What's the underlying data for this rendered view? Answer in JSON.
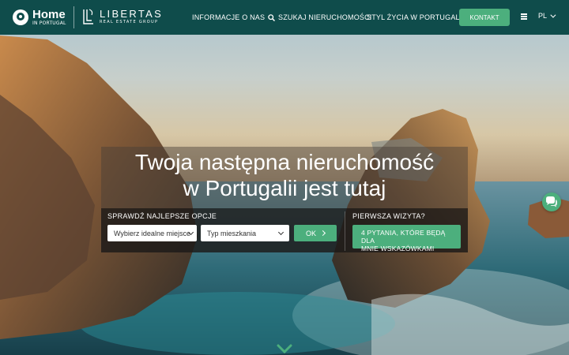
{
  "header": {
    "logo_home": {
      "title": "Home",
      "subtitle": "IN PORTUGAL"
    },
    "logo_libertas": {
      "title": "LIBERTAS",
      "subtitle": "REAL ESTATE GROUP"
    },
    "nav": {
      "about": "INFORMACJE O NAS",
      "search": "SZUKAJ NIERUCHOMOŚCI",
      "lifestyle": "STYL ŻYCIA W PORTUGALII"
    },
    "contact_label": "KONTAKT",
    "language": "PL"
  },
  "hero": {
    "headline_line1": "Twoja następna nieruchomość",
    "headline_line2": "w Portugalii jest tutaj"
  },
  "search_panel": {
    "best_options_label": "SPRAWDŹ NAJLEPSZE OPCJE",
    "place_select": "Wybierz idealne miejsce",
    "type_select": "Typ mieszkania",
    "ok_label": "OK",
    "first_visit_label": "PIERWSZA WIZYTA?",
    "quiz_line1": "4 PYTANIA, KTÓRE BĘDĄ DLA",
    "quiz_line2": "MNIE WSKAZÓWKAMI"
  },
  "colors": {
    "header_bg": "#0f4c4b",
    "accent": "#4caf7d"
  },
  "icons": {
    "search": "search-icon",
    "menu": "hamburger-menu-icon",
    "chat": "chat-icon",
    "scroll": "chevron-down-icon"
  }
}
